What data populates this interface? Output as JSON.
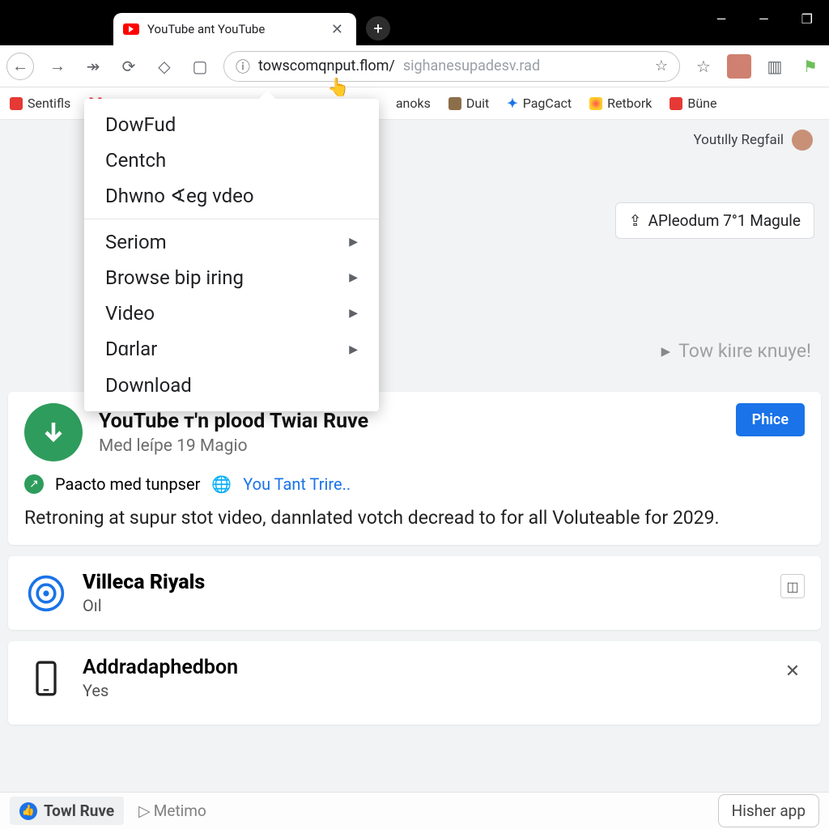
{
  "tab": {
    "title": "YouTube ant YouTube"
  },
  "win": {
    "min": "—",
    "mid": "—",
    "max": "❐"
  },
  "address": {
    "main": "towscomqnput.flom/",
    "faded": "sighanesupadesv.rad"
  },
  "bookmarks": [
    "Sentifls",
    "",
    "anoks",
    "Duit",
    "PagCact",
    "Retbork",
    "Büne"
  ],
  "header_user": "Youtılly Regfail",
  "magule": "APleodum 7°1 Magule",
  "kime": "Tow kiıre кnuye!",
  "menu": {
    "g1": [
      "DowFud",
      "Centch",
      "Dhwno ∢eg vdeo"
    ],
    "g2": [
      "Seriom",
      "Browse bip iring",
      "Video",
      "Dɑrlar",
      "Download"
    ]
  },
  "card1": {
    "title": "YouTube т'n plood Twiaı Ruve",
    "sub": "Med leípe 19 Magio",
    "btn": "Phice",
    "meta1": "Paacto med tunpser",
    "meta2": "You Tant Trire..",
    "desc": "Retroning at supur stot video, dannlated votch decread to for all Voluteable for 2029."
  },
  "card2": {
    "title": "Villeca Riyals",
    "sub": "Oıl"
  },
  "card3": {
    "title": "Addradaphedbon",
    "sub": "Yes"
  },
  "footer": {
    "chip": "Towl Ruve",
    "metimo": "Metimo",
    "app": "Hisher app"
  }
}
